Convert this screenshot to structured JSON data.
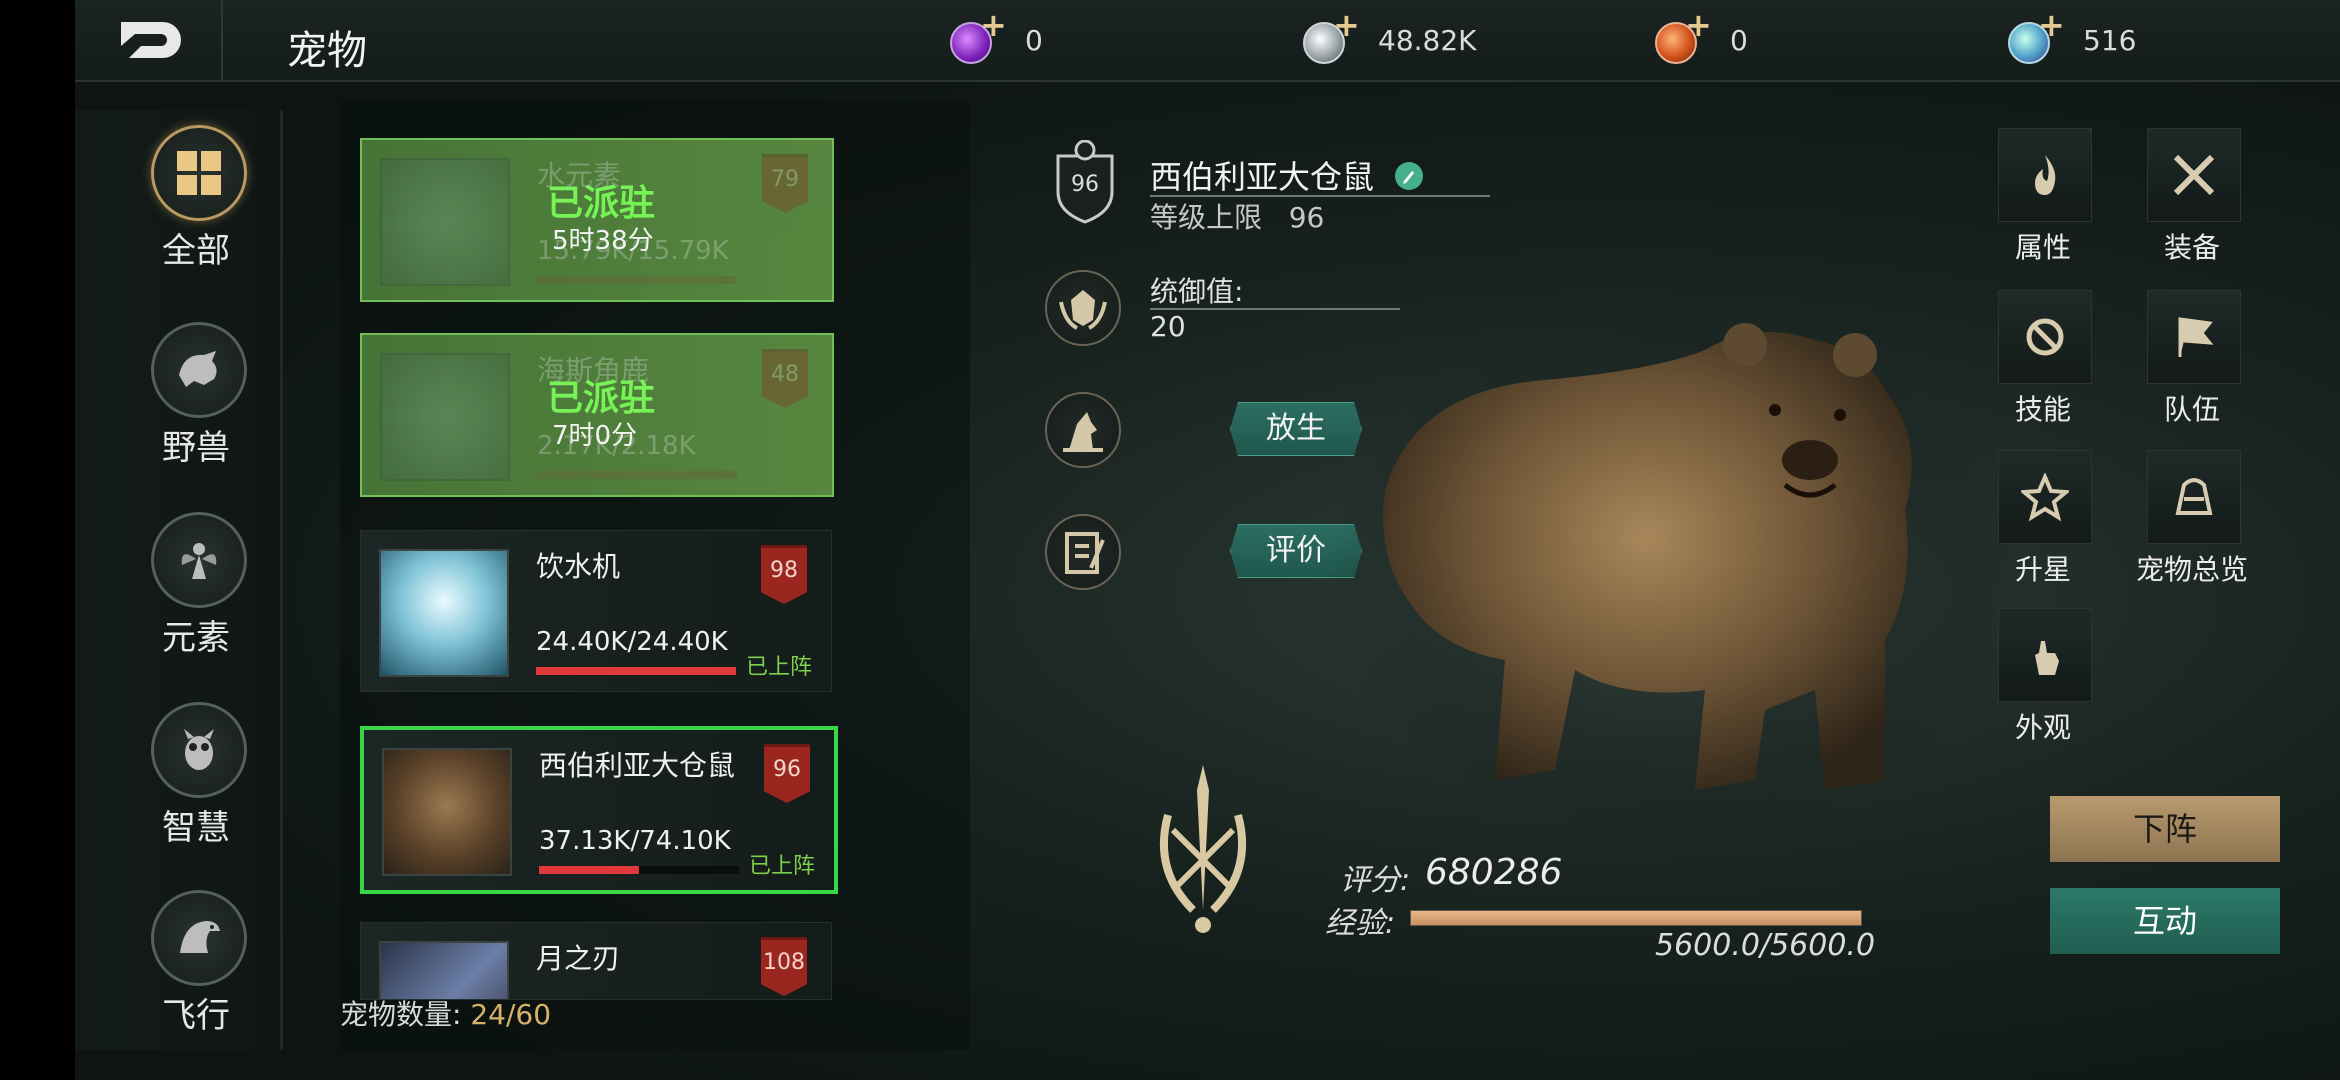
{
  "header": {
    "title": "宠物",
    "resources": [
      {
        "icon": "purple-gem-icon",
        "value": "0"
      },
      {
        "icon": "silver-coin-icon",
        "value": "48.82K"
      },
      {
        "icon": "orange-gem-icon",
        "value": "0"
      },
      {
        "icon": "blue-crystal-icon",
        "value": "516"
      }
    ]
  },
  "categories": [
    {
      "label": "全部",
      "icon": "grid-icon",
      "active": true
    },
    {
      "label": "野兽",
      "icon": "beast-icon",
      "active": false
    },
    {
      "label": "元素",
      "icon": "fairy-icon",
      "active": false
    },
    {
      "label": "智慧",
      "icon": "owl-icon",
      "active": false
    },
    {
      "label": "飞行",
      "icon": "eagle-icon",
      "active": false
    }
  ],
  "pets": [
    {
      "name": "水元素",
      "level": "79",
      "hp": "15.79K/15.79K",
      "status": "已派驻",
      "time": "5时38分",
      "hp_fraction": 1.0
    },
    {
      "name": "海斯角鹿",
      "level": "48",
      "hp": "2.17K/2.18K",
      "status": "已派驻",
      "time": "7时0分",
      "hp_fraction": 1.0
    },
    {
      "name": "饮水机",
      "level": "98",
      "hp": "24.40K/24.40K",
      "status": "已上阵",
      "hp_fraction": 1.0
    },
    {
      "name": "西伯利亚大仓鼠",
      "level": "96",
      "hp": "37.13K/74.10K",
      "status": "已上阵",
      "hp_fraction": 0.5
    },
    {
      "name": "月之刃",
      "level": "108"
    }
  ],
  "pet_count": {
    "label": "宠物数量:",
    "value": "24/60"
  },
  "detail": {
    "name": "西伯利亚大仓鼠",
    "level_badge": "96",
    "level_cap_label": "等级上限",
    "level_cap_value": "96",
    "command_label": "统御值:",
    "command_value": "20",
    "release_button": "放生",
    "review_button": "评价",
    "score_label": "评分:",
    "score_value": "680286",
    "exp_label": "经验:",
    "exp_value": "5600.0/5600.0",
    "exp_fraction": 1.0
  },
  "menu": [
    {
      "label": "属性",
      "icon": "flame-icon"
    },
    {
      "label": "装备",
      "icon": "crossed-swords-icon"
    },
    {
      "label": "技能",
      "icon": "skill-icon"
    },
    {
      "label": "队伍",
      "icon": "flag-icon"
    },
    {
      "label": "升星",
      "icon": "star-icon"
    },
    {
      "label": "宠物总览",
      "icon": "overview-icon"
    },
    {
      "label": "外观",
      "icon": "hand-icon"
    }
  ],
  "actions": {
    "withdraw": "下阵",
    "interact": "互动"
  }
}
